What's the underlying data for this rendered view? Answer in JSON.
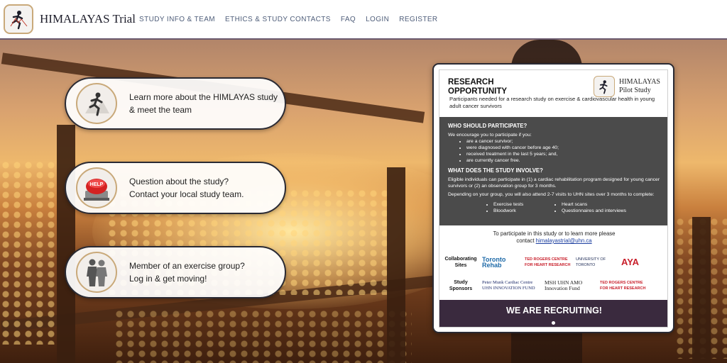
{
  "header": {
    "brand": "HIMALAYAS Trial",
    "nav": [
      "STUDY INFO & TEAM",
      "ETHICS & STUDY CONTACTS",
      "FAQ",
      "LOGIN",
      "REGISTER"
    ]
  },
  "cards": [
    {
      "icon": "runner-icon",
      "line1": "Learn more about the HIMLAYAS study",
      "line2": "& meet the team"
    },
    {
      "icon": "help-button-icon",
      "line1": "Question about the study?",
      "line2": "Contact your local study team."
    },
    {
      "icon": "people-icon",
      "line1": "Member of an exercise group?",
      "line2": "Log in & get moving!"
    }
  ],
  "flyer": {
    "heading1": "RESEARCH",
    "heading2": "OPPORTUNITY",
    "logo_line1": "HIMALAYAS",
    "logo_line2": "Pilot Study",
    "intro": "Participants needed for a research study on exercise & cardiovascular health in young adult cancer survivors",
    "who_heading": "WHO SHOULD PARTICIPATE?",
    "who_intro": "We encourage you to participate if you:",
    "who_items": [
      "are a cancer survivor;",
      "were diagnosed with cancer before age 40;",
      "received treatment in the last 5 years; and,",
      "are currently cancer free."
    ],
    "what_heading": "WHAT DOES THE STUDY INVOLVE?",
    "what_p1": "Eligible individuals can participate in (1) a cardiac rehabilitation program designed for young cancer survivors or (2) an observation group for 3 months.",
    "what_p2": "Depending on your group, you will also attend 2-7 visits to UHN sites over 3 months to complete:",
    "col1": [
      "Exercise tests",
      "Bloodwork"
    ],
    "col2": [
      "Heart scans",
      "Questionnaires and interviews"
    ],
    "contact_line1": "To participate in this study or to learn more please",
    "contact_prefix": "contact",
    "contact_email": "himalayastrial@uhn.ca",
    "collab_label1": "Collaborating",
    "collab_label2": "Sites",
    "collab_logos": [
      "Toronto Rehab",
      "TED ROGERS CENTRE FOR HEART RESEARCH",
      "UNIVERSITY OF TORONTO",
      "AYA"
    ],
    "sponsor_label1": "Study",
    "sponsor_label2": "Sponsors",
    "sponsor_logos": [
      "Peter Munk Cardiac Centre UHN INNOVATION FUND",
      "MSH UHN AMO Innovation Fund",
      "TED ROGERS CENTRE FOR HEART RESEARCH"
    ],
    "banner": "WE ARE RECRUITING!"
  },
  "colors": {
    "accent": "#3a2a3e",
    "link": "#1c3fa0",
    "gold": "#c9a97a"
  }
}
